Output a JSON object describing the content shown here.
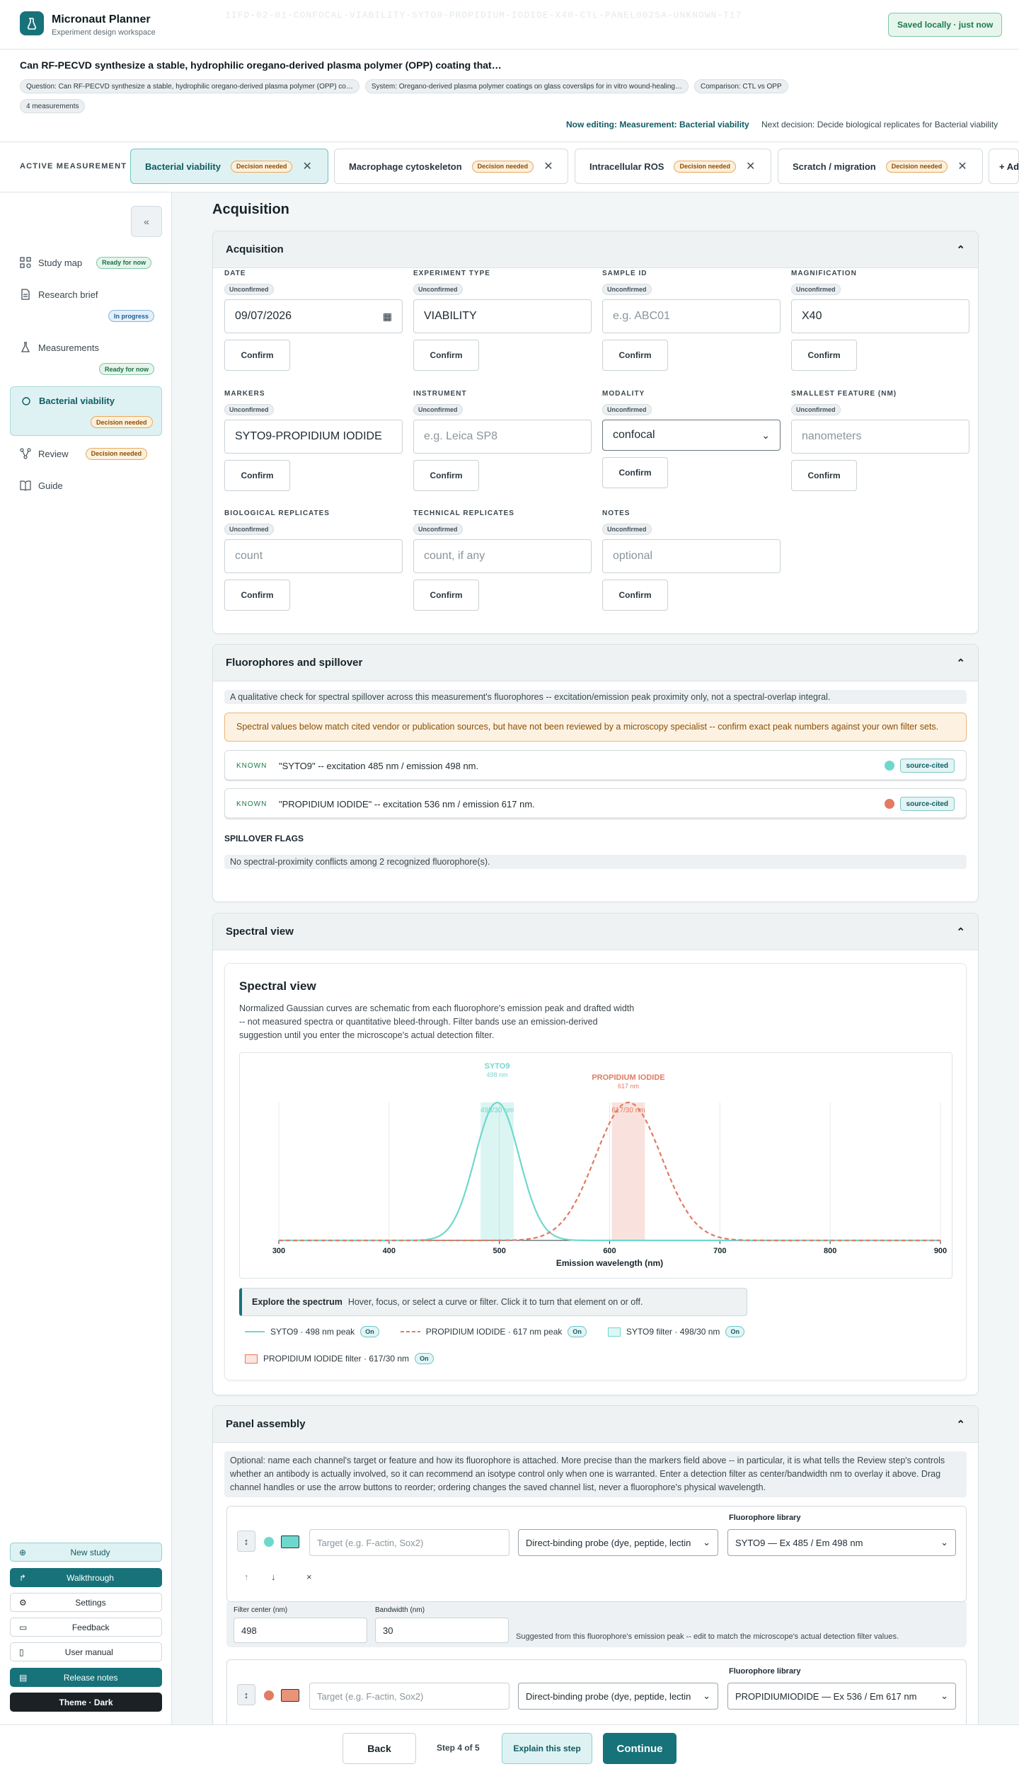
{
  "app": {
    "title": "Micronaut Planner",
    "subtitle": "Experiment design workspace",
    "hidden_id": "1IFD-02-01-CONFOCAL-VIABILITY-SYTO9-PROPIDIUM-IODIDE-X40-CTL-PANEL0025A-UNKNOWN-T17",
    "saved": "Saved locally · just now"
  },
  "question": {
    "title": "Can RF-PECVD synthesize a stable, hydrophilic oregano-derived plasma polymer (OPP) coating that…",
    "chips": [
      "Question: Can RF-PECVD synthesize a stable, hydrophilic oregano-derived plasma polymer (OPP) co…",
      "System: Oregano-derived plasma polymer coatings on glass coverslips for in vitro wound-healing…",
      "Comparison: CTL vs OPP",
      "4 measurements"
    ],
    "now_editing": "Now editing: Measurement: Bacterial viability",
    "next_decision": "Next decision: Decide biological replicates for Bacterial viability"
  },
  "measurements": {
    "label": "ACTIVE MEASUREMENT",
    "tabs": [
      {
        "label": "Bacterial viability",
        "badge": "Decision needed"
      },
      {
        "label": "Macrophage cytoskeleton",
        "badge": "Decision needed"
      },
      {
        "label": "Intracellular ROS",
        "badge": "Decision needed"
      },
      {
        "label": "Scratch / migration",
        "badge": "Decision needed"
      }
    ],
    "add": "+ Ad"
  },
  "sidebar": {
    "items": [
      {
        "label": "Study map",
        "badge": "Ready for now"
      },
      {
        "label": "Research brief",
        "badge": "In progress"
      },
      {
        "label": "Measurements",
        "badge": "Ready for now"
      },
      {
        "label": "Bacterial viability",
        "badge": "Decision needed"
      },
      {
        "label": "Review",
        "badge": "Decision needed"
      },
      {
        "label": "Guide"
      }
    ],
    "buttons": [
      "New study",
      "Walkthrough",
      "Settings",
      "Feedback",
      "User manual",
      "Release notes",
      "Theme · Dark"
    ]
  },
  "page_heading": "Acquisition",
  "acquisition": {
    "title": "Acquisition",
    "unconfirmed": "Unconfirmed",
    "confirm": "Confirm",
    "fields": [
      {
        "label": "DATE",
        "value": "09/07/2026"
      },
      {
        "label": "EXPERIMENT TYPE",
        "value": "VIABILITY"
      },
      {
        "label": "SAMPLE ID",
        "placeholder": "e.g. ABC01"
      },
      {
        "label": "MAGNIFICATION",
        "value": "X40"
      },
      {
        "label": "MARKERS",
        "value": "SYTO9-PROPIDIUM IODIDE"
      },
      {
        "label": "INSTRUMENT",
        "placeholder": "e.g. Leica SP8"
      },
      {
        "label": "MODALITY",
        "value": "confocal"
      },
      {
        "label": "SMALLEST FEATURE (NM)",
        "placeholder": "nanometers"
      },
      {
        "label": "BIOLOGICAL REPLICATES",
        "placeholder": "count"
      },
      {
        "label": "TECHNICAL REPLICATES",
        "placeholder": "count, if any"
      },
      {
        "label": "NOTES",
        "placeholder": "optional"
      }
    ]
  },
  "fluorophores": {
    "title": "Fluorophores and spillover",
    "intro": "A qualitative check for spectral spillover across this measurement's fluorophores -- excitation/emission peak proximity only, not a spectral-overlap integral.",
    "warning": "Spectral values below match cited vendor or publication sources, but have not been reviewed by a microscopy specialist -- confirm exact peak numbers against your own filter sets.",
    "known_label": "KNOWN",
    "rows": [
      {
        "text": "\"SYTO9\" -- excitation 485 nm / emission 498 nm.",
        "color": "#6fd8cd",
        "tag": "source-cited"
      },
      {
        "text": "\"PROPIDIUM IODIDE\" -- excitation 536 nm / emission 617 nm.",
        "color": "#e27b62",
        "tag": "source-cited"
      }
    ],
    "spillover_title": "SPILLOVER FLAGS",
    "spillover_text": "No spectral-proximity conflicts among 2 recognized fluorophore(s)."
  },
  "spectral": {
    "card_title": "Spectral view",
    "inner_title": "Spectral view",
    "description": "Normalized Gaussian curves are schematic from each fluorophore's emission peak and drafted width -- not measured spectra or quantitative bleed-through. Filter bands use an emission-derived suggestion until you enter the microscope's actual detection filter.",
    "explore_title": "Explore the spectrum",
    "explore_text": "Hover, focus, or select a curve or filter. Click it to turn that element on or off.",
    "legend": [
      {
        "label": "SYTO9 · 498 nm peak",
        "state": "On"
      },
      {
        "label": "PROPIDIUM IODIDE · 617 nm peak",
        "state": "On"
      },
      {
        "label": "SYTO9 filter · 498/30 nm",
        "state": "On"
      },
      {
        "label": "PROPIDIUM IODIDE filter · 617/30 nm",
        "state": "On"
      }
    ]
  },
  "chart_data": {
    "type": "line",
    "xlabel": "Emission wavelength (nm)",
    "ylabel": "",
    "xlim": [
      300,
      900
    ],
    "x_ticks": [
      300,
      400,
      500,
      600,
      700,
      800,
      900
    ],
    "series": [
      {
        "name": "SYTO9",
        "peak": 498,
        "peak_label": "498 nm",
        "sigma": 20,
        "color": "#6fd8cd",
        "dashed": false
      },
      {
        "name": "PROPIDIUM IODIDE",
        "peak": 617,
        "peak_label": "617 nm",
        "sigma": 30,
        "color": "#e27b62",
        "dashed": true
      }
    ],
    "filters": [
      {
        "label": "498/30 nm",
        "center": 498,
        "width": 30,
        "color": "#6fd8cd"
      },
      {
        "label": "617/30 nm",
        "center": 617,
        "width": 30,
        "color": "#e27b62"
      }
    ]
  },
  "panel": {
    "title": "Panel assembly",
    "intro": "Optional: name each channel's target or feature and how its fluorophore is attached. More precise than the markers field above -- in particular, it is what tells the Review step's controls whether an antibody is actually involved, so it can recommend an isotype control only when one is warranted. Enter a detection filter as center/bandwidth nm to overlay it above. Drag channel handles or use the arrow buttons to reorder; ordering changes the saved channel list, never a fluorophore's physical wavelength.",
    "library_label": "Fluorophore library",
    "target_placeholder": "Target (e.g. F-actin, Sox2)",
    "binding": "Direct-binding probe (dye, peptide, lectin",
    "channels": [
      {
        "library": "SYTO9 — Ex 485 / Em 498 nm",
        "color": "#6fd8cd",
        "filter_center": "498",
        "bandwidth": "30"
      },
      {
        "library": "PROPIDIUMIODIDE — Ex 536 / Em 617 nm",
        "color": "#e27b62"
      }
    ],
    "filter_center_label": "Filter center (nm)",
    "bandwidth_label": "Bandwidth (nm)",
    "filter_hint": "Suggested from this fluorophore's emission peak -- edit to match the microscope's actual detection filter values."
  },
  "footer": {
    "back": "Back",
    "step": "Step 4 of 5",
    "explain": "Explain this step",
    "continue": "Continue"
  }
}
